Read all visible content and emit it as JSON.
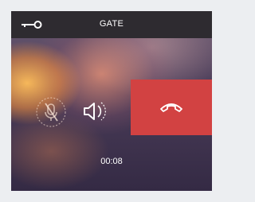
{
  "header": {
    "title": "GATE",
    "key_icon": "key-icon"
  },
  "controls": {
    "mic_icon": "mic-muted-icon",
    "mic_state": "muted",
    "speaker_icon": "speaker-icon",
    "hangup_icon": "phone-hangup-icon",
    "hangup_color": "#d24242"
  },
  "call": {
    "duration": "00:08"
  }
}
